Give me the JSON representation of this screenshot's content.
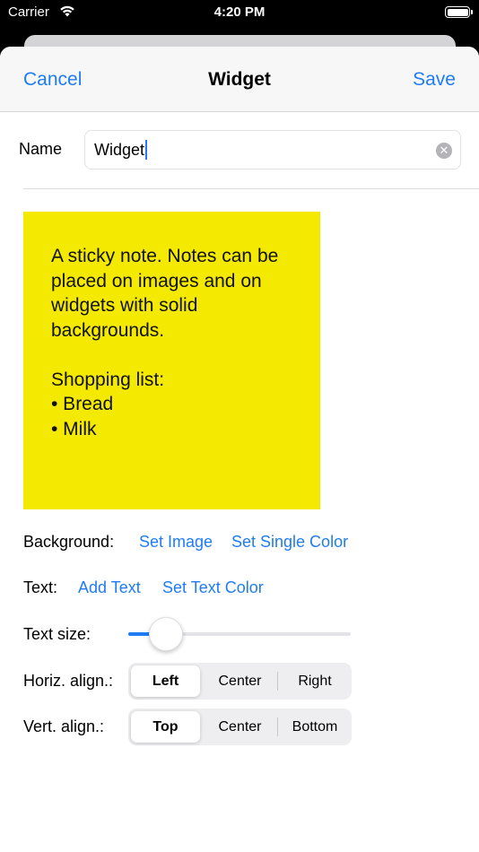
{
  "status_bar": {
    "carrier": "Carrier",
    "time": "4:20 PM"
  },
  "nav": {
    "cancel_label": "Cancel",
    "title": "Widget",
    "save_label": "Save"
  },
  "name": {
    "label": "Name",
    "value": "Widget"
  },
  "sticky_note": {
    "color": "#f4e900",
    "paragraph1": "A sticky note. Notes can be placed on images and on widgets with solid backgrounds.",
    "paragraph2": "Shopping list:",
    "items": [
      "• Bread",
      "• Milk"
    ]
  },
  "background_row": {
    "label": "Background:",
    "set_image": "Set Image",
    "set_single_color": "Set Single Color"
  },
  "text_row": {
    "label": "Text:",
    "add_text": "Add Text",
    "set_text_color": "Set Text Color"
  },
  "text_size": {
    "label": "Text size:",
    "value_fraction": 0.17
  },
  "horiz_align": {
    "label": "Horiz. align.:",
    "options": [
      "Left",
      "Center",
      "Right"
    ],
    "selected": "Left"
  },
  "vert_align": {
    "label": "Vert. align.:",
    "options": [
      "Top",
      "Center",
      "Bottom"
    ],
    "selected": "Top"
  },
  "colors": {
    "accent": "#1f7cf4",
    "sticky": "#f4e900"
  }
}
